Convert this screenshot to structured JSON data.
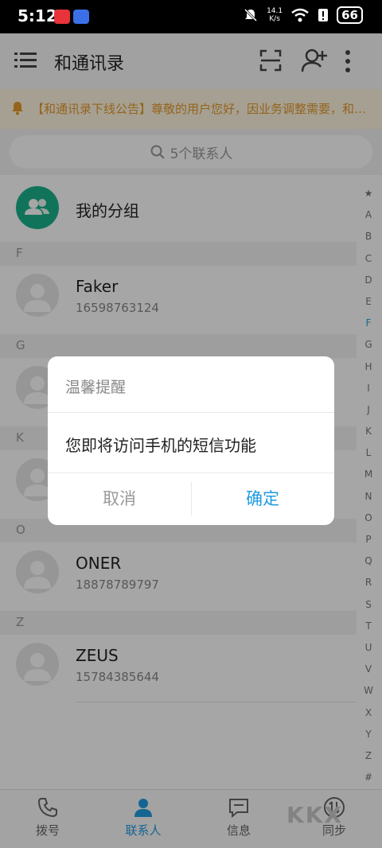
{
  "status_bar": {
    "time": "5:12",
    "speed_value": "14.1",
    "speed_unit": "K/s",
    "battery": "66"
  },
  "app_bar": {
    "title": "和通讯录"
  },
  "notice": {
    "text": "【和通讯录下线公告】尊敬的用户您好，因业务调整需要，和通讯录将于近期停止服务"
  },
  "search": {
    "placeholder": "5个联系人"
  },
  "group_row": {
    "label": "我的分组"
  },
  "sections": [
    "F",
    "G",
    "K",
    "O",
    "Z"
  ],
  "contacts": [
    {
      "name": "Faker",
      "phone": "16598763124"
    },
    {
      "name": "ONER",
      "phone": "18878789797"
    },
    {
      "name": "ZEUS",
      "phone": "15784385644"
    }
  ],
  "index_letters": [
    "★",
    "A",
    "B",
    "C",
    "D",
    "E",
    "F",
    "G",
    "H",
    "I",
    "J",
    "K",
    "L",
    "M",
    "N",
    "O",
    "P",
    "Q",
    "R",
    "S",
    "T",
    "U",
    "V",
    "W",
    "X",
    "Y",
    "Z",
    "#"
  ],
  "index_active": "F",
  "bottom_nav": [
    {
      "label": "拨号",
      "icon": "phone-icon",
      "active": false
    },
    {
      "label": "联系人",
      "icon": "contacts-icon",
      "active": true
    },
    {
      "label": "信息",
      "icon": "message-icon",
      "active": false
    },
    {
      "label": "同步",
      "icon": "sync-icon",
      "active": false
    }
  ],
  "watermark": "KKX",
  "dialog": {
    "title": "温馨提醒",
    "message": "您即将访问手机的短信功能",
    "cancel_label": "取消",
    "confirm_label": "确定"
  },
  "colors": {
    "accent": "#1f9be0",
    "notice_text": "#e39a2b",
    "group_avatar": "#1bb28a"
  }
}
